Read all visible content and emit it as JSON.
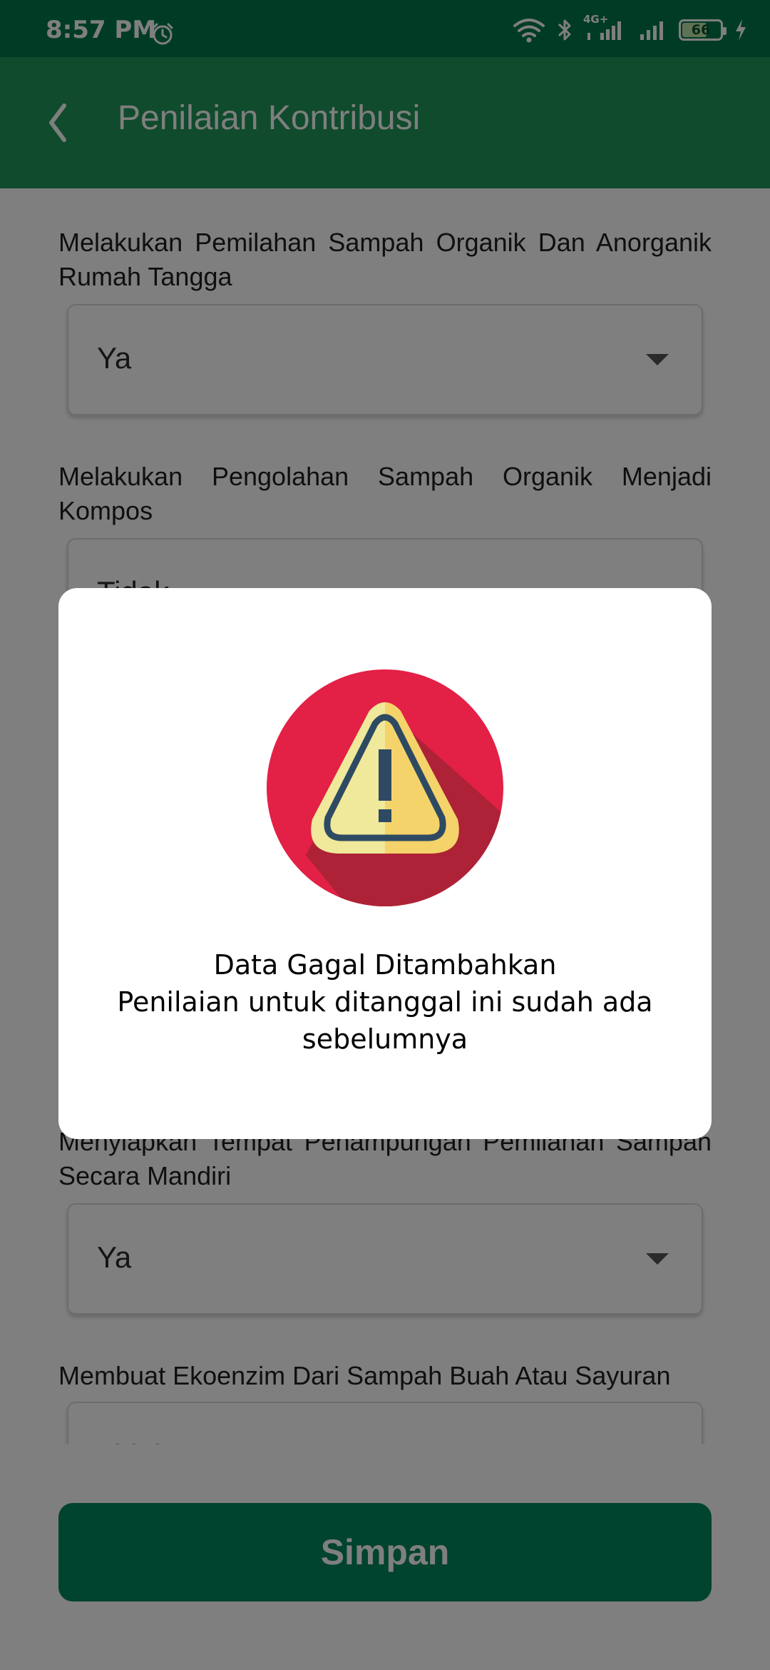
{
  "status_bar": {
    "time": "8:57 PM",
    "network_label": "4G+",
    "battery_level": 66,
    "icons": [
      "alarm-icon",
      "wifi-icon",
      "bluetooth-icon",
      "signal-4g-icon",
      "signal-icon",
      "battery-icon",
      "charging-icon"
    ]
  },
  "app_bar": {
    "title": "Penilaian Kontribusi",
    "back_icon": "chevron-left-icon"
  },
  "form": {
    "questions": [
      {
        "label": "Melakukan Pemilahan Sampah Organik Dan Anorganik Rumah Tangga",
        "value": "Ya"
      },
      {
        "label": "Melakukan Pengolahan Sampah Organik Menjadi Kompos",
        "value": "Tidak"
      },
      {
        "label": "Menyiapkan Tempat Penampungan Pemilahan Sampah Secara Mandiri",
        "value": "Ya"
      },
      {
        "label": "Membuat Ekoenzim Dari Sampah Buah Atau Sayuran",
        "value": "Tidak"
      }
    ],
    "save_label": "Simpan"
  },
  "dialog": {
    "icon": "warning-icon",
    "title": "Data Gagal Ditambahkan",
    "message": "Penilaian untuk ditanggal ini sudah ada sebelumnya"
  },
  "colors": {
    "status_bar": "#00794a",
    "app_bar": "#21965b",
    "save_button": "#00875f",
    "warning_circle": "#e32046",
    "warning_triangle_light": "#f0e89a",
    "warning_triangle_dark": "#f4d36a",
    "warning_mark": "#2e4a63"
  }
}
